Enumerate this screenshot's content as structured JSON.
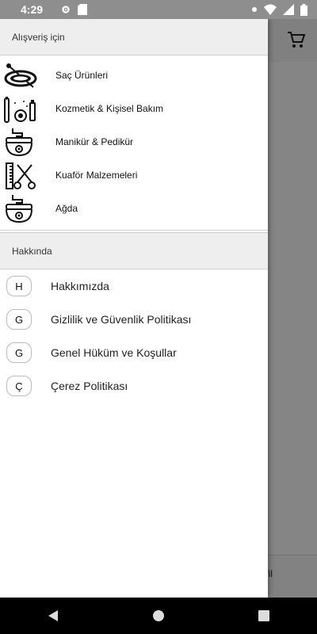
{
  "status_bar": {
    "time": "4:29",
    "icons": [
      "settings-icon",
      "sd-card-icon",
      "notification-dot-icon",
      "wifi-icon",
      "signal-icon",
      "battery-icon"
    ]
  },
  "background": {
    "profile_peek_text": "fil",
    "icons": [
      "cart-icon"
    ]
  },
  "drawer": {
    "shop_section": {
      "title": "Alışveriş için",
      "items": [
        {
          "label": "Saç Ürünleri",
          "icon": "hair-clip-icon"
        },
        {
          "label": "Kozmetik & Kişisel Bakım",
          "icon": "cosmetics-icon"
        },
        {
          "label": "Manikür & Pedikür",
          "icon": "nail-care-icon"
        },
        {
          "label": "Kuaför Malzemeleri",
          "icon": "scissors-comb-icon"
        },
        {
          "label": "Ağda",
          "icon": "wax-jar-icon"
        }
      ]
    },
    "about_section": {
      "title": "Hakkında",
      "items": [
        {
          "letter": "H",
          "label": "Hakkımızda"
        },
        {
          "letter": "G",
          "label": "Gizlilik ve Güvenlik Politikası"
        },
        {
          "letter": "G",
          "label": "Genel Hüküm ve Koşullar"
        },
        {
          "letter": "Ç",
          "label": "Çerez Politikası"
        }
      ]
    }
  },
  "nav_bar": {
    "icons": [
      "back-icon",
      "home-icon",
      "recents-icon"
    ]
  }
}
